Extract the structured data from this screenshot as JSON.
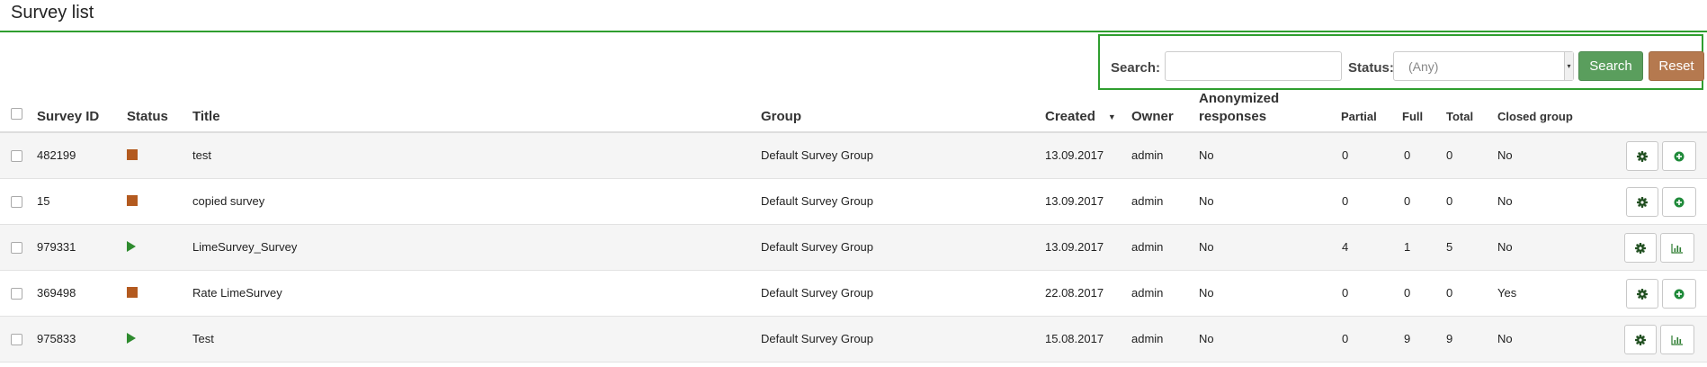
{
  "page": {
    "title": "Survey list"
  },
  "search": {
    "search_label": "Search:",
    "search_value": "",
    "status_label": "Status:",
    "status_value": "(Any)",
    "search_button": "Search",
    "reset_button": "Reset"
  },
  "table": {
    "headers": {
      "survey_id": "Survey ID",
      "status": "Status",
      "title": "Title",
      "group": "Group",
      "created": "Created",
      "owner": "Owner",
      "anonymized": "Anonymized responses",
      "partial": "Partial",
      "full": "Full",
      "total": "Total",
      "closed_group": "Closed group"
    },
    "rows": [
      {
        "survey_id": "482199",
        "status": "stop-icon",
        "title": "test",
        "group": "Default Survey Group",
        "created": "13.09.2017",
        "owner": "admin",
        "anonymized": "No",
        "partial": "0",
        "full": "0",
        "total": "0",
        "closed_group": "No",
        "second_action": "add-icon"
      },
      {
        "survey_id": "15",
        "status": "stop-icon",
        "title": "copied survey",
        "group": "Default Survey Group",
        "created": "13.09.2017",
        "owner": "admin",
        "anonymized": "No",
        "partial": "0",
        "full": "0",
        "total": "0",
        "closed_group": "No",
        "second_action": "add-icon"
      },
      {
        "survey_id": "979331",
        "status": "play-icon",
        "title": "LimeSurvey_Survey",
        "group": "Default Survey Group",
        "created": "13.09.2017",
        "owner": "admin",
        "anonymized": "No",
        "partial": "4",
        "full": "1",
        "total": "5",
        "closed_group": "No",
        "second_action": "statistics-icon"
      },
      {
        "survey_id": "369498",
        "status": "stop-icon",
        "title": "Rate LimeSurvey",
        "group": "Default Survey Group",
        "created": "22.08.2017",
        "owner": "admin",
        "anonymized": "No",
        "partial": "0",
        "full": "0",
        "total": "0",
        "closed_group": "Yes",
        "second_action": "add-icon"
      },
      {
        "survey_id": "975833",
        "status": "play-icon",
        "title": "Test",
        "group": "Default Survey Group",
        "created": "15.08.2017",
        "owner": "admin",
        "anonymized": "No",
        "partial": "0",
        "full": "9",
        "total": "9",
        "closed_group": "No",
        "second_action": "statistics-icon"
      }
    ]
  },
  "colors": {
    "accent_green": "#2f9e2f",
    "search_button": "#5a9e5d",
    "reset_button": "#b5794f",
    "inactive_status": "#b35a1f",
    "active_status": "#2e8b2e"
  }
}
